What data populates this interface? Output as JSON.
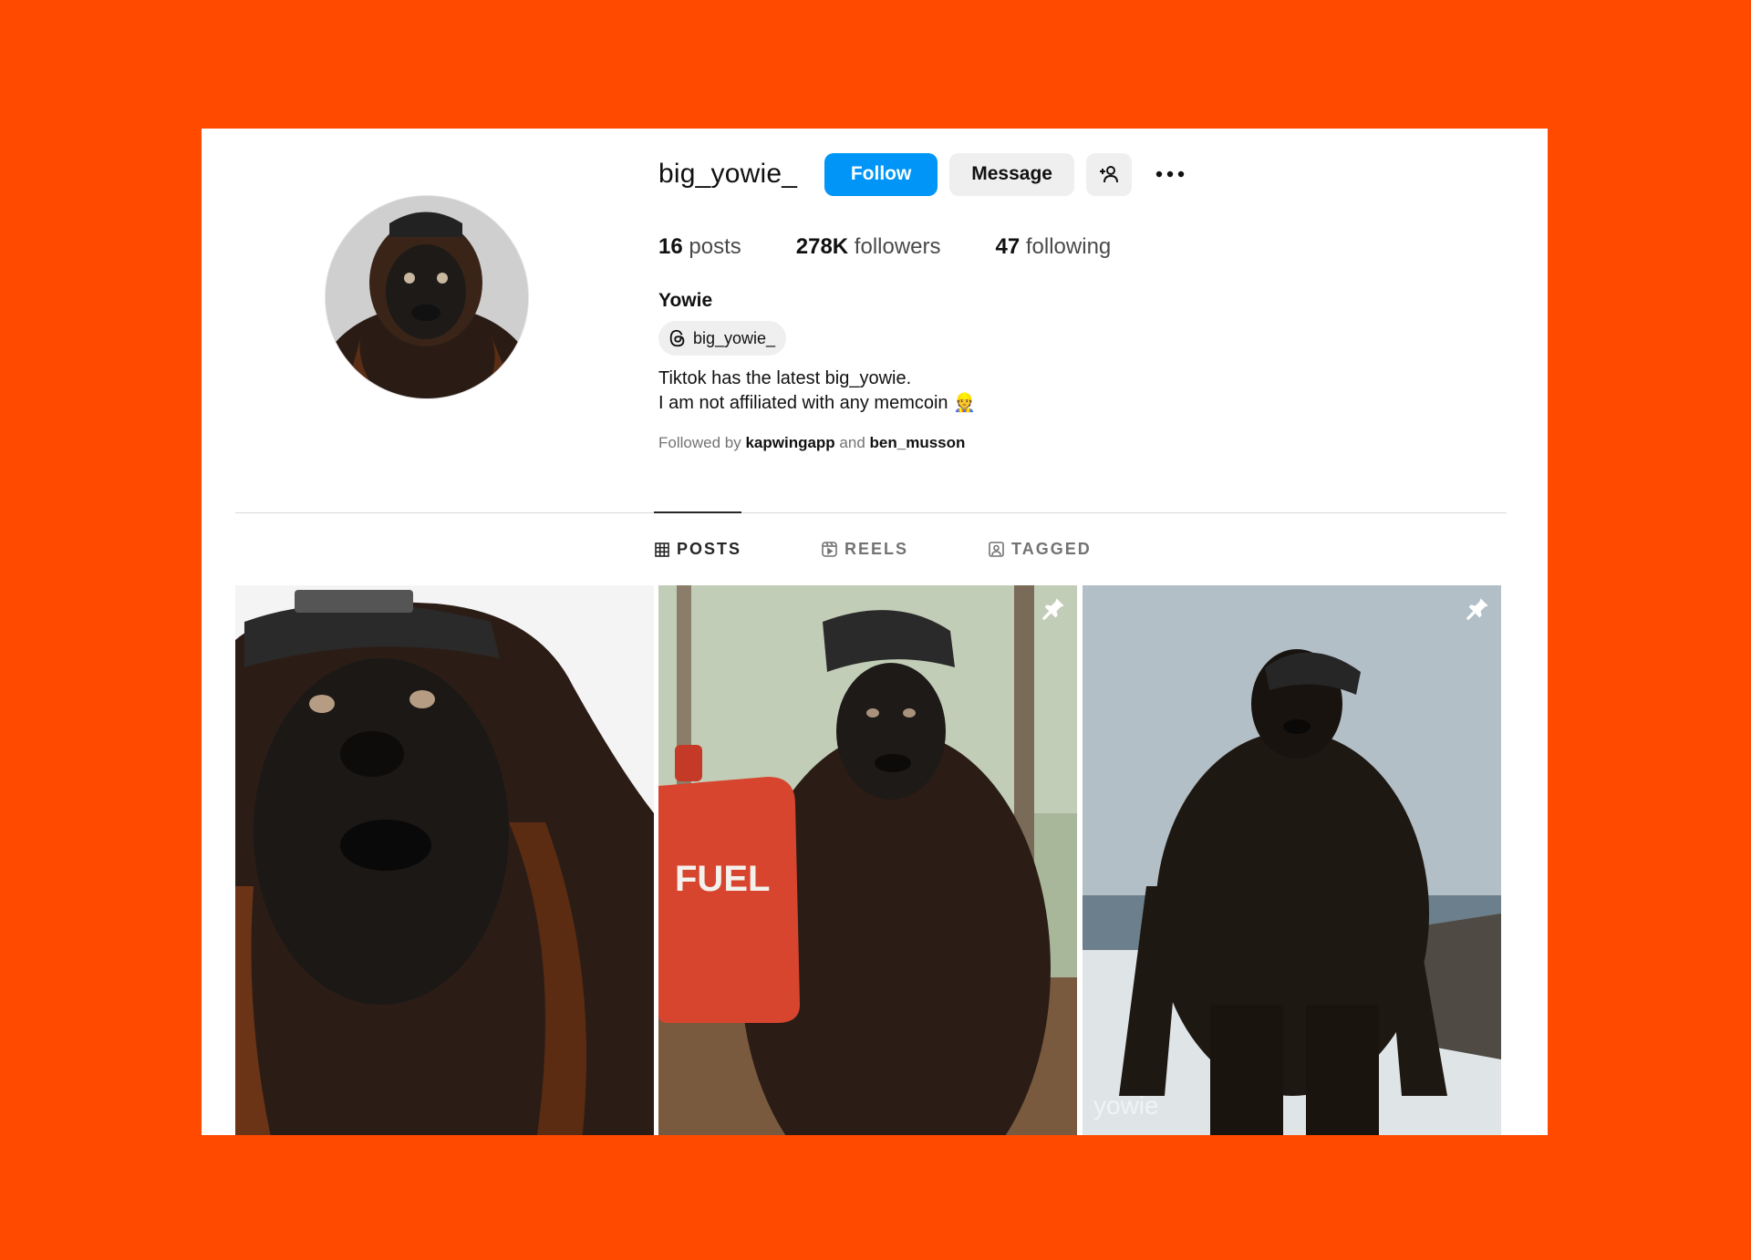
{
  "profile": {
    "username": "big_yowie_",
    "full_name": "Yowie",
    "threads_handle": "big_yowie_",
    "bio_line1": "Tiktok has the latest big_yowie.",
    "bio_line2": "I am not affiliated with any memcoin 👷",
    "followed_by_prefix": "Followed by",
    "followed_by_user1": "kapwingapp",
    "followed_by_and": "and",
    "followed_by_user2": "ben_musson"
  },
  "actions": {
    "follow_label": "Follow",
    "message_label": "Message"
  },
  "stats": {
    "posts_count": "16",
    "posts_label": "posts",
    "followers_count": "278K",
    "followers_label": "followers",
    "following_count": "47",
    "following_label": "following"
  },
  "tabs": [
    {
      "label": "POSTS",
      "icon": "grid-icon",
      "active": true
    },
    {
      "label": "REELS",
      "icon": "reels-icon",
      "active": false
    },
    {
      "label": "TAGGED",
      "icon": "tagged-icon",
      "active": false
    }
  ],
  "posts": [
    {
      "alt": "yowie close-up",
      "pinned": false
    },
    {
      "alt": "yowie holding fuel can",
      "pinned": true,
      "caption_on_image": "FUEL"
    },
    {
      "alt": "yowie standing on beach",
      "pinned": true,
      "caption_on_image": "yowie"
    }
  ],
  "colors": {
    "background": "#ff4a00",
    "follow_button": "#0095f6",
    "secondary_button": "#efefef"
  }
}
